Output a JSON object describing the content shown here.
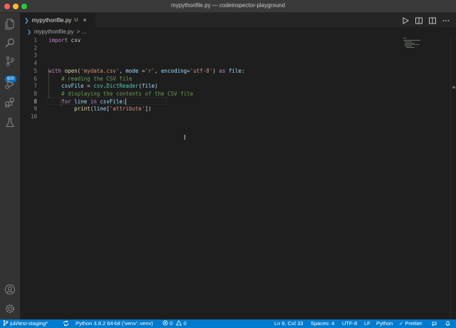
{
  "window": {
    "title": "mypythonfile.py — codeinspector-playground"
  },
  "activity_bar": {
    "items": [
      {
        "name": "explorer",
        "icon": "files-icon"
      },
      {
        "name": "search",
        "icon": "search-icon"
      },
      {
        "name": "source-control",
        "icon": "source-control-icon",
        "badge": "600"
      },
      {
        "name": "run-debug",
        "icon": "run-debug-icon"
      },
      {
        "name": "extensions",
        "icon": "extensions-icon"
      },
      {
        "name": "testing",
        "icon": "flask-icon"
      }
    ],
    "bottom": [
      {
        "name": "accounts",
        "icon": "account-icon"
      },
      {
        "name": "manage",
        "icon": "gear-icon"
      }
    ]
  },
  "tab": {
    "filename": "mypythonfile.py",
    "status": "U",
    "close": "×"
  },
  "tab_actions": [
    "run-icon",
    "split-compare-icon",
    "split-editor-icon",
    "more-icon"
  ],
  "breadcrumb": {
    "file": "mypythonfile.py",
    "more": "> ..."
  },
  "editor": {
    "active_line": 9,
    "lines": [
      {
        "n": "1",
        "tokens": [
          {
            "t": "import",
            "c": "kw"
          },
          {
            "t": " csv",
            "c": "plain"
          }
        ]
      },
      {
        "n": "2",
        "tokens": []
      },
      {
        "n": "3",
        "tokens": []
      },
      {
        "n": "4",
        "tokens": []
      },
      {
        "n": "5",
        "tokens": [
          {
            "t": "with",
            "c": "kw"
          },
          {
            "t": " ",
            "c": "plain"
          },
          {
            "t": "open",
            "c": "fn"
          },
          {
            "t": "(",
            "c": "plain"
          },
          {
            "t": "'mydata.csv'",
            "c": "str"
          },
          {
            "t": ", ",
            "c": "plain"
          },
          {
            "t": "mode",
            "c": "var"
          },
          {
            "t": " =",
            "c": "plain"
          },
          {
            "t": "'r'",
            "c": "str"
          },
          {
            "t": ", ",
            "c": "plain"
          },
          {
            "t": "encoding",
            "c": "var"
          },
          {
            "t": "=",
            "c": "plain"
          },
          {
            "t": "'utf-8'",
            "c": "str"
          },
          {
            "t": ") ",
            "c": "plain"
          },
          {
            "t": "as",
            "c": "kw"
          },
          {
            "t": " ",
            "c": "plain"
          },
          {
            "t": "file",
            "c": "var"
          },
          {
            "t": ":",
            "c": "plain"
          }
        ]
      },
      {
        "n": "6",
        "tokens": [
          {
            "t": "    ",
            "c": "plain"
          },
          {
            "t": "# reading the CSV file",
            "c": "cmt"
          }
        ]
      },
      {
        "n": "7",
        "tokens": [
          {
            "t": "    ",
            "c": "plain"
          },
          {
            "t": "csvFile",
            "c": "var"
          },
          {
            "t": " = ",
            "c": "plain"
          },
          {
            "t": "csv",
            "c": "cls"
          },
          {
            "t": ".",
            "c": "plain"
          },
          {
            "t": "DictReader",
            "c": "cls"
          },
          {
            "t": "(",
            "c": "plain"
          },
          {
            "t": "file",
            "c": "var"
          },
          {
            "t": ")",
            "c": "plain"
          }
        ]
      },
      {
        "n": "8",
        "tokens": [
          {
            "t": "    ",
            "c": "plain"
          },
          {
            "t": "# displaying the contents of the CSV file",
            "c": "cmt"
          }
        ]
      },
      {
        "n": "8",
        "tokens": [
          {
            "t": "    ",
            "c": "plain"
          },
          {
            "t": "for",
            "c": "kw"
          },
          {
            "t": " ",
            "c": "plain"
          },
          {
            "t": "line",
            "c": "var"
          },
          {
            "t": " ",
            "c": "plain"
          },
          {
            "t": "in",
            "c": "kw"
          },
          {
            "t": " ",
            "c": "plain"
          },
          {
            "t": "csvFile",
            "c": "var"
          },
          {
            "t": ":",
            "c": "plain"
          }
        ]
      },
      {
        "n": "9",
        "tokens": [
          {
            "t": "        ",
            "c": "plain"
          },
          {
            "t": "print",
            "c": "fn"
          },
          {
            "t": "(",
            "c": "plain"
          },
          {
            "t": "line",
            "c": "var"
          },
          {
            "t": "[",
            "c": "plain"
          },
          {
            "t": "'attribute'",
            "c": "str"
          },
          {
            "t": "])",
            "c": "plain"
          }
        ]
      },
      {
        "n": "10",
        "tokens": []
      }
    ]
  },
  "statusbar": {
    "branch": "juli/test-staging*",
    "sync_icon": "sync-icon",
    "interpreter": "Python 3.8.2 64-bit ('venv': venv)",
    "errors": "0",
    "warnings": "0",
    "position": "Ln 9, Col 33",
    "spaces": "Spaces: 4",
    "encoding": "UTF-8",
    "eol": "LF",
    "language": "Python",
    "prettier": "Prettier"
  },
  "colors": {
    "statusbar": "#007acc",
    "activitybar": "#333333",
    "editor_bg": "#1e1e1e",
    "keyword": "#c586c0",
    "string": "#ce9178",
    "comment": "#6a9955",
    "function": "#dcdcaa"
  }
}
